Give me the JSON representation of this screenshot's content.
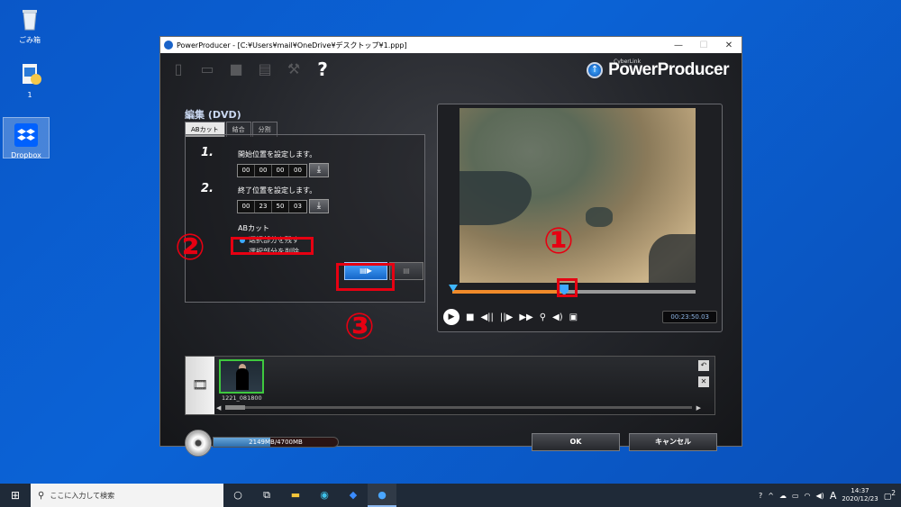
{
  "desktop": {
    "icons": [
      {
        "label": "ごみ箱"
      },
      {
        "label": "1"
      },
      {
        "label": "Dropbox"
      }
    ]
  },
  "window": {
    "title": "PowerProducer - [C:¥Users¥mail¥OneDrive¥デスクトップ¥1.ppp]",
    "minimize": "—",
    "maximize": "☐",
    "close": "✕"
  },
  "brand": {
    "small": "CyberLink",
    "name": "PowerProducer"
  },
  "toolbar": {
    "help": "?"
  },
  "edit": {
    "title": "編集 (DVD)",
    "tabs": [
      "ABカット",
      "結合",
      "分割"
    ],
    "step1": {
      "num": "1.",
      "label": "開始位置を設定します。",
      "time": [
        "00",
        "00",
        "00",
        "00"
      ]
    },
    "step2": {
      "num": "2.",
      "label": "終了位置を設定します。",
      "time": [
        "00",
        "23",
        "50",
        "03"
      ]
    },
    "step3": {
      "label": "ABカット"
    },
    "option_keep": "選択部分を残す",
    "option_delete": "選択部分を削除"
  },
  "preview": {
    "timecode": "00:23:50.03",
    "progress": 0.46
  },
  "timeline": {
    "clip_label": "1221_081800"
  },
  "capacity": {
    "text": "2149MB/4700MB",
    "used_fraction": 0.457
  },
  "buttons": {
    "ok": "OK",
    "cancel": "キャンセル"
  },
  "annotations": {
    "n1": "①",
    "n2": "②",
    "n3": "③"
  },
  "taskbar": {
    "search_placeholder": "ここに入力して検索",
    "ime": "A",
    "time": "14:37",
    "date": "2020/12/23",
    "notif_count": "2"
  }
}
